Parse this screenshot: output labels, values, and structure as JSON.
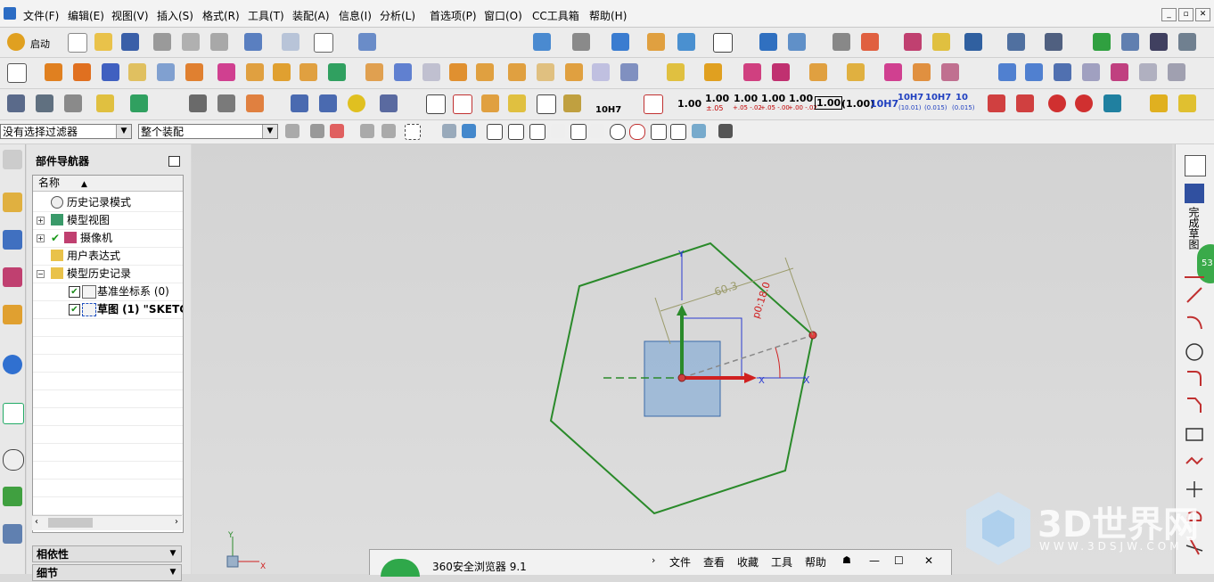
{
  "menubar": {
    "items": [
      "文件(F)",
      "编辑(E)",
      "视图(V)",
      "插入(S)",
      "格式(R)",
      "工具(T)",
      "装配(A)",
      "信息(I)",
      "分析(L)",
      "首选项(P)",
      "窗口(O)",
      "CC工具箱",
      "帮助(H)"
    ]
  },
  "toolbar": {
    "start_label": "启动",
    "dims": [
      "1.00",
      "1.00",
      "1.00",
      "1.00",
      "1.00",
      "1.00",
      "(1.00)",
      "10H7",
      "10H7",
      "10H7",
      "10"
    ],
    "dim_subs": [
      "±.05",
      "+.05 -.02",
      "+.05 -.00",
      "+.00 -.02",
      "",
      "",
      "",
      "",
      "(10.01)",
      "(0.015)",
      "(0.015)"
    ],
    "tol_label": "10H7"
  },
  "selection": {
    "filter": "没有选择过滤器",
    "scope": "整个装配"
  },
  "navigator": {
    "title": "部件导航器",
    "column_header": "名称",
    "items": [
      {
        "label": "历史记录模式"
      },
      {
        "label": "模型视图"
      },
      {
        "label": "摄像机"
      },
      {
        "label": "用户表达式"
      },
      {
        "label": "模型历史记录"
      },
      {
        "label": "基准坐标系 (0)"
      },
      {
        "label": "草图 (1) \"SKETC"
      }
    ],
    "panels": [
      "相依性",
      "细节"
    ]
  },
  "sketch": {
    "dim_distance": "60.3",
    "dim_angle": "p0:18.0",
    "axis_x": "X",
    "axis_y": "Y"
  },
  "right_panel": {
    "vertical_label": "完成草图",
    "badge": "53"
  },
  "browser": {
    "title": "360安全浏览器 9.1",
    "menus": [
      "文件",
      "查看",
      "收藏",
      "工具",
      "帮助"
    ]
  },
  "watermark": {
    "text": "3D世界网",
    "url": "WWW.3DSJW.COM"
  }
}
